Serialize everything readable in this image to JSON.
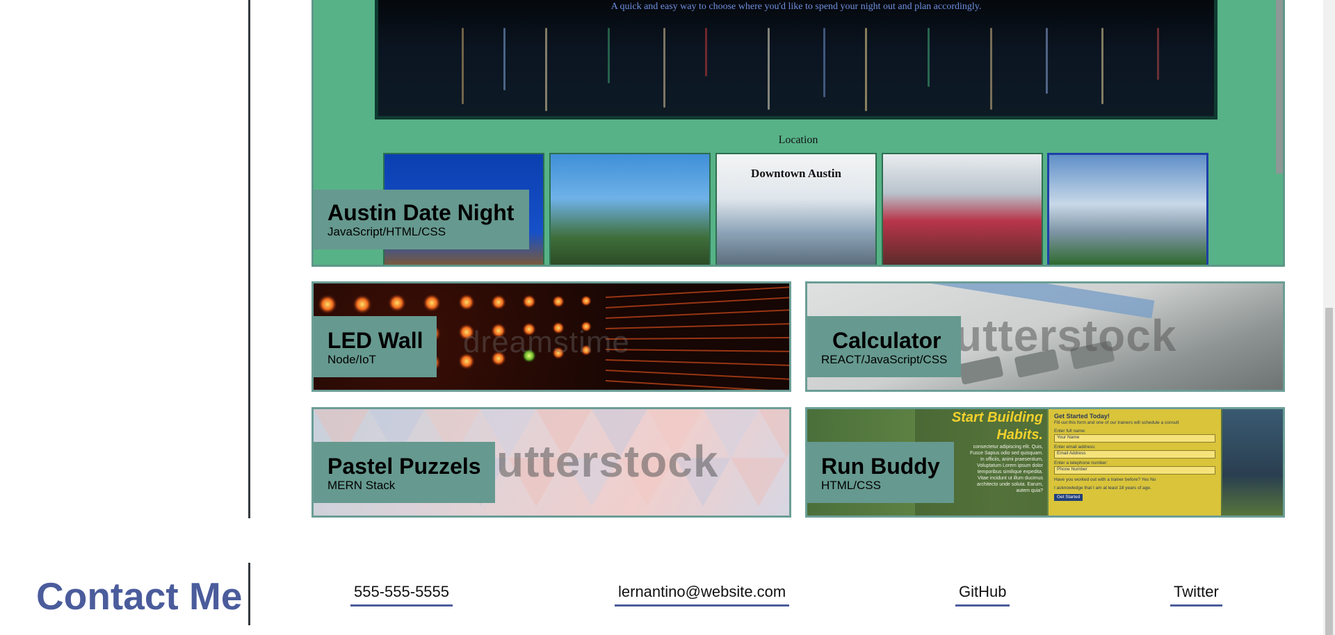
{
  "featured": {
    "subtitle": "A quick and easy way to choose where you'd like to spend your night out and plan accordingly.",
    "location_label": "Location",
    "thumbnails": [
      {
        "title": ""
      },
      {
        "title": ""
      },
      {
        "title": "Downtown Austin"
      },
      {
        "title": ""
      },
      {
        "title": ""
      }
    ],
    "name": "Austin Date Night",
    "stack": "JavaScript/HTML/CSS"
  },
  "projects": [
    {
      "name": "LED Wall",
      "stack": "Node/IoT",
      "watermark": "dreamstime"
    },
    {
      "name": "Calculator",
      "stack": "REACT/JavaScript/CSS",
      "watermark": "utterstock"
    },
    {
      "name": "Pastel Puzzels",
      "stack": "MERN Stack",
      "watermark": "utterstock"
    },
    {
      "name": "Run Buddy",
      "stack": "HTML/CSS",
      "watermark": ""
    }
  ],
  "run_buddy_preview": {
    "headline_line1": "Start Building",
    "headline_line2": "Habits.",
    "form_title": "Get Started Today!",
    "form_intro": "Fill out this form and one of our trainers will schedule a consult",
    "name_label": "Enter full name:",
    "name_placeholder": "Your Name",
    "email_label": "Enter email address:",
    "email_placeholder": "Email Address",
    "phone_label": "Enter a telephone number:",
    "phone_placeholder": "Phone Number",
    "question": "Have you worked out with a trainer before?",
    "yes": "Yes",
    "no": "No",
    "ack": "I acknowledge that I am at least 18 years of age.",
    "submit": "Get Started",
    "body_text": "consectetur adipiscing elit. Quis, Fusce Sapius odio sed quisquam. In officiis, animi praesentium, Voluptatum Lorem ipsum dolor temporibus similique expedita. Vitae incidunt ut illum ducimus architecto unde soluta. Earum, autem quia?"
  },
  "contact": {
    "title": "Contact Me",
    "phone": "555-555-5555",
    "email": "lernantino@website.com",
    "github": "GitHub",
    "twitter": "Twitter"
  },
  "colors": {
    "accent": "#4b5c9c",
    "featured_bg": "#57b287",
    "label_bg": "#66998f"
  }
}
